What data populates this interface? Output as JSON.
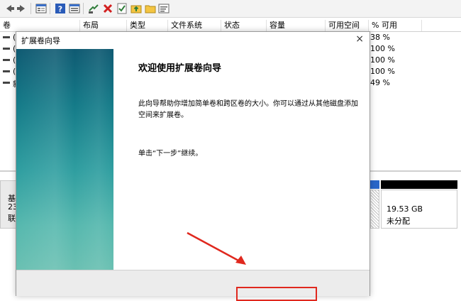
{
  "toolbar": {
    "icons": [
      "back-arrow-icon",
      "forward-arrow-icon",
      "properties-icon",
      "help-icon",
      "settings-icon",
      "connect-icon",
      "delete-icon",
      "check-icon",
      "folder-up-icon",
      "folder-icon",
      "info-icon"
    ]
  },
  "columns": [
    "卷",
    "布局",
    "类型",
    "文件系统",
    "状态",
    "容量",
    "可用空间",
    "% 可用"
  ],
  "volumes": [
    {
      "label": "(",
      "pct": "38 %"
    },
    {
      "label": "(",
      "pct": "100 %"
    },
    {
      "label": "(",
      "pct": "100 %"
    },
    {
      "label": "(",
      "pct": "100 %"
    },
    {
      "label": "新",
      "pct": "49 %"
    }
  ],
  "disk": {
    "left_labels": [
      "基",
      "23",
      "联"
    ],
    "unalloc_size": "19.53 GB",
    "unalloc_label": "未分配"
  },
  "dialog": {
    "title": "扩展卷向导",
    "close": "×",
    "heading": "欢迎使用扩展卷向导",
    "body": "此向导帮助你增加简单卷和跨区卷的大小。你可以通过从其他磁盘添加空间来扩展卷。",
    "prompt": "单击“下一步”继续。"
  },
  "colors": {
    "annotation": "#e0281e",
    "banner_top": "#0f5a72",
    "banner_bottom": "#6ac0b2"
  }
}
